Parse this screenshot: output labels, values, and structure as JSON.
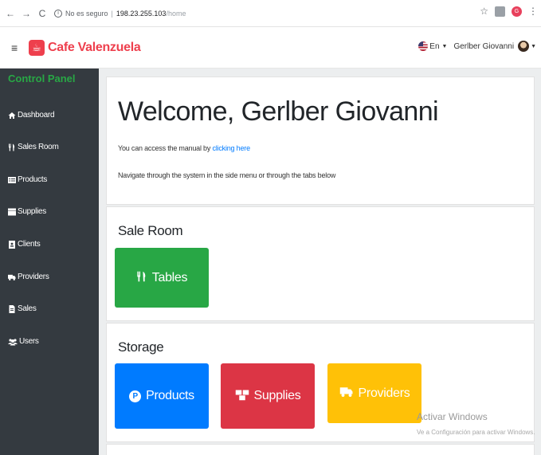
{
  "browser": {
    "back_icon": "←",
    "forward_icon": "→",
    "reload_icon": "C",
    "info_icon": "i",
    "security_text": "No es seguro",
    "separator": "|",
    "host": "198.23.255.103",
    "path": "/home",
    "star_icon": "☆",
    "profile_letter": "G",
    "menu_icon": "⋮"
  },
  "topbar": {
    "hamburger_icon": "≡",
    "brand_logo_glyph": "☕",
    "brand_name": "Cafe Valenzuela",
    "language": "En",
    "user_name": "Gerlber Giovanni",
    "caret": "▼"
  },
  "sidebar": {
    "title": "Control Panel",
    "items": [
      {
        "label": "Dashboard",
        "icon": "home-icon",
        "glyph": "🏠"
      },
      {
        "label": "Sales Room",
        "icon": "utensils-icon",
        "glyph": "🍴"
      },
      {
        "label": "Products",
        "icon": "list-icon",
        "glyph": "▤"
      },
      {
        "label": "Supplies",
        "icon": "boxes-icon",
        "glyph": "▦"
      },
      {
        "label": "Clients",
        "icon": "id-card-icon",
        "glyph": "▣"
      },
      {
        "label": "Providers",
        "icon": "truck-icon",
        "glyph": "🚚"
      },
      {
        "label": "Sales",
        "icon": "file-icon",
        "glyph": "▧"
      },
      {
        "label": "Users",
        "icon": "users-icon",
        "glyph": "👥"
      }
    ]
  },
  "welcome": {
    "title": "Welcome, Gerlber Giovanni",
    "manual_prefix": "You can access the manual by ",
    "manual_link": "clicking here",
    "navigate_text": "Navigate through the system in the side menu or through the tabs below"
  },
  "sale_room": {
    "title": "Sale Room",
    "tables_label": "Tables",
    "tables_glyph": "🍴"
  },
  "storage": {
    "title": "Storage",
    "products_label": "Products",
    "products_glyph": "P",
    "supplies_label": "Supplies",
    "supplies_glyph": "📦",
    "providers_label": "Providers",
    "providers_glyph": "🚚"
  },
  "watermark": {
    "line1": "Activar Windows",
    "line2": "Ve a Configuración para activar Windows."
  },
  "colors": {
    "brand": "#ee3f4d",
    "sidebar_bg": "#343a40",
    "sidebar_title": "#28a745",
    "green": "#28a745",
    "blue": "#007bff",
    "red": "#dc3545",
    "yellow": "#ffc107"
  }
}
